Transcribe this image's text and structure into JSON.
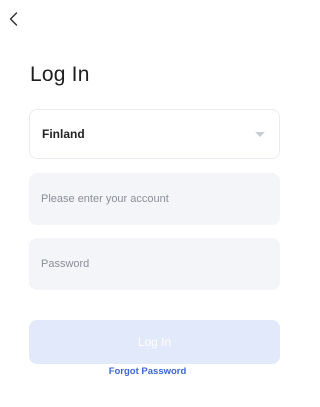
{
  "header": {
    "back_icon": "chevron-left-icon"
  },
  "title": "Log In",
  "country_select": {
    "value": "Finland",
    "caret_icon": "caret-down-icon"
  },
  "account_input": {
    "placeholder": "Please enter your account",
    "value": ""
  },
  "password_input": {
    "placeholder": "Password",
    "value": ""
  },
  "login_button": {
    "label": "Log In"
  },
  "forgot_password": {
    "label": "Forgot Password"
  },
  "colors": {
    "accent": "#3a66d6",
    "login_button_disabled": "#e1e9fb",
    "input_background": "#f4f5f9"
  }
}
